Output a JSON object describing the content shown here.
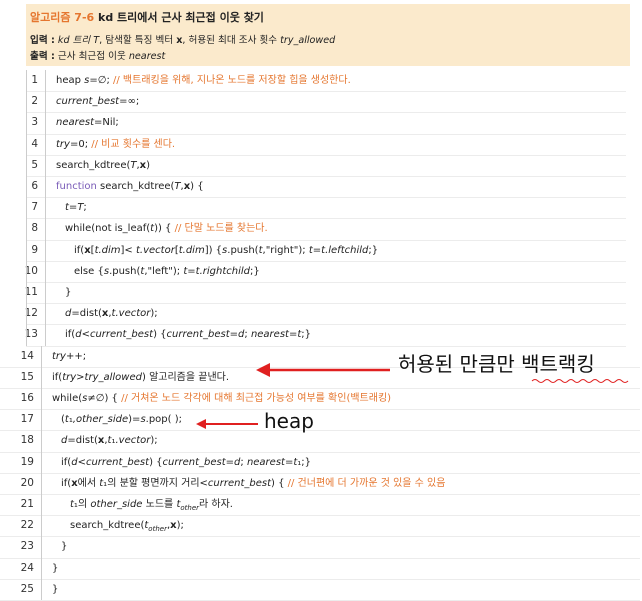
{
  "header": {
    "algorithm": "알고리즘 7-6",
    "title": "kd 트리에서 근사 최근접 이웃 찾기",
    "input_label": "입력 :",
    "input_text_1": " kd 트리 ",
    "input_T": "T",
    "input_text_2": ", 탐색할 특징 벡터 ",
    "input_x": "x",
    "input_text_3": ", 허용된 최대 조사 횟수 ",
    "input_try_allowed": "try_allowed",
    "output_label": "출력 :",
    "output_text": " 근사 최근접 이웃 ",
    "output_nearest": "nearest"
  },
  "code_lines": [
    {
      "num": "1",
      "html_parts": [
        {
          "t": "heap ",
          "s": ""
        },
        {
          "t": "s",
          "s": "i"
        },
        {
          "t": "=∅;  ",
          "s": ""
        },
        {
          "t": "// 백트래킹을 위해, 지나온 노드를 저장할 힙을 생성한다.",
          "s": "cm"
        }
      ]
    },
    {
      "num": "2",
      "html_parts": [
        {
          "t": "current_best",
          "s": "i"
        },
        {
          "t": "=∞;",
          "s": ""
        }
      ]
    },
    {
      "num": "3",
      "html_parts": [
        {
          "t": "nearest",
          "s": "i"
        },
        {
          "t": "=Nil;",
          "s": ""
        }
      ]
    },
    {
      "num": "4",
      "html_parts": [
        {
          "t": "try",
          "s": "i"
        },
        {
          "t": "=0;   ",
          "s": ""
        },
        {
          "t": "// 비교 횟수를 센다.",
          "s": "cm"
        }
      ]
    },
    {
      "num": "5",
      "html_parts": [
        {
          "t": "search_kdtree(",
          "s": ""
        },
        {
          "t": "T",
          "s": "i"
        },
        {
          "t": ",",
          "s": ""
        },
        {
          "t": "x",
          "s": "b"
        },
        {
          "t": ")",
          "s": ""
        }
      ]
    },
    {
      "num": "6",
      "html_parts": [
        {
          "t": "function",
          "s": "kw"
        },
        {
          "t": " search_kdtree(",
          "s": ""
        },
        {
          "t": "T",
          "s": "i"
        },
        {
          "t": ",",
          "s": ""
        },
        {
          "t": "x",
          "s": "b"
        },
        {
          "t": ") {",
          "s": ""
        }
      ]
    },
    {
      "num": "7",
      "html_parts": [
        {
          "t": "t",
          "s": "i"
        },
        {
          "t": "=",
          "s": ""
        },
        {
          "t": "T",
          "s": "i"
        },
        {
          "t": ";",
          "s": ""
        }
      ]
    },
    {
      "num": "8",
      "html_parts": [
        {
          "t": "while(not is_leaf(",
          "s": ""
        },
        {
          "t": "t",
          "s": "i"
        },
        {
          "t": ")) {  ",
          "s": ""
        },
        {
          "t": "// 단말 노드를 찾는다.",
          "s": "cm"
        }
      ]
    },
    {
      "num": "9",
      "html_parts": [
        {
          "t": "if(",
          "s": ""
        },
        {
          "t": "x",
          "s": "b"
        },
        {
          "t": "[",
          "s": ""
        },
        {
          "t": "t.dim",
          "s": "i"
        },
        {
          "t": "]< ",
          "s": ""
        },
        {
          "t": "t.vector",
          "s": "i"
        },
        {
          "t": "[",
          "s": ""
        },
        {
          "t": "t.dim",
          "s": "i"
        },
        {
          "t": "]) {",
          "s": ""
        },
        {
          "t": "s",
          "s": "i"
        },
        {
          "t": ".push(",
          "s": ""
        },
        {
          "t": "t",
          "s": "i"
        },
        {
          "t": ",\"right\"); ",
          "s": ""
        },
        {
          "t": "t",
          "s": "i"
        },
        {
          "t": "=",
          "s": ""
        },
        {
          "t": "t.leftchild",
          "s": "i"
        },
        {
          "t": ";}",
          "s": ""
        }
      ]
    },
    {
      "num": "10",
      "html_parts": [
        {
          "t": "else {",
          "s": ""
        },
        {
          "t": "s",
          "s": "i"
        },
        {
          "t": ".push(",
          "s": ""
        },
        {
          "t": "t",
          "s": "i"
        },
        {
          "t": ",\"left\"); ",
          "s": ""
        },
        {
          "t": "t",
          "s": "i"
        },
        {
          "t": "=",
          "s": ""
        },
        {
          "t": "t.rightchild",
          "s": "i"
        },
        {
          "t": ";}",
          "s": ""
        }
      ]
    },
    {
      "num": "11",
      "html_parts": [
        {
          "t": "}",
          "s": ""
        }
      ]
    },
    {
      "num": "12",
      "html_parts": [
        {
          "t": "d",
          "s": "i"
        },
        {
          "t": "=dist(",
          "s": ""
        },
        {
          "t": "x",
          "s": "b"
        },
        {
          "t": ",",
          "s": ""
        },
        {
          "t": "t.vector",
          "s": "i"
        },
        {
          "t": ");",
          "s": ""
        }
      ]
    },
    {
      "num": "13",
      "html_parts": [
        {
          "t": "if(",
          "s": ""
        },
        {
          "t": "d",
          "s": "i"
        },
        {
          "t": "<",
          "s": ""
        },
        {
          "t": "current_best",
          "s": "i"
        },
        {
          "t": ") {",
          "s": ""
        },
        {
          "t": "current_best",
          "s": "i"
        },
        {
          "t": "=",
          "s": ""
        },
        {
          "t": "d",
          "s": "i"
        },
        {
          "t": "; ",
          "s": ""
        },
        {
          "t": "nearest",
          "s": "i"
        },
        {
          "t": "=",
          "s": ""
        },
        {
          "t": "t",
          "s": "i"
        },
        {
          "t": ";}",
          "s": ""
        }
      ]
    },
    {
      "num": "14",
      "html_parts": [
        {
          "t": "try",
          "s": "i"
        },
        {
          "t": "++;",
          "s": ""
        }
      ]
    },
    {
      "num": "15",
      "html_parts": [
        {
          "t": "if(",
          "s": ""
        },
        {
          "t": "try",
          "s": "i"
        },
        {
          "t": ">",
          "s": ""
        },
        {
          "t": "try_allowed",
          "s": "i"
        },
        {
          "t": ") 알고리즘을 끝낸다.",
          "s": ""
        }
      ]
    },
    {
      "num": "16",
      "html_parts": [
        {
          "t": "while(",
          "s": ""
        },
        {
          "t": "s",
          "s": "i"
        },
        {
          "t": "≠∅) {  ",
          "s": ""
        },
        {
          "t": "// 거쳐온 노드 각각에 대해 최근접 가능성 여부를 확인(백트래킹)",
          "s": "cm"
        }
      ]
    },
    {
      "num": "17",
      "html_parts": [
        {
          "t": "(",
          "s": ""
        },
        {
          "t": "t",
          "s": "i"
        },
        {
          "t": "₁",
          "s": ""
        },
        {
          "t": ",other_side",
          "s": "i"
        },
        {
          "t": ")=",
          "s": ""
        },
        {
          "t": "s",
          "s": "i"
        },
        {
          "t": ".pop( );",
          "s": ""
        }
      ]
    },
    {
      "num": "18",
      "html_parts": [
        {
          "t": "d",
          "s": "i"
        },
        {
          "t": "=dist(",
          "s": ""
        },
        {
          "t": "x",
          "s": "b"
        },
        {
          "t": ",",
          "s": ""
        },
        {
          "t": "t",
          "s": "i"
        },
        {
          "t": "₁",
          "s": ""
        },
        {
          "t": ".vector",
          "s": "i"
        },
        {
          "t": ");",
          "s": ""
        }
      ]
    },
    {
      "num": "19",
      "html_parts": [
        {
          "t": "if(",
          "s": ""
        },
        {
          "t": "d",
          "s": "i"
        },
        {
          "t": "<",
          "s": ""
        },
        {
          "t": "current_best",
          "s": "i"
        },
        {
          "t": ") {",
          "s": ""
        },
        {
          "t": "current_best",
          "s": "i"
        },
        {
          "t": "=",
          "s": ""
        },
        {
          "t": "d",
          "s": "i"
        },
        {
          "t": "; ",
          "s": ""
        },
        {
          "t": "nearest",
          "s": "i"
        },
        {
          "t": "=",
          "s": ""
        },
        {
          "t": "t",
          "s": "i"
        },
        {
          "t": "₁",
          "s": ""
        },
        {
          "t": ";}",
          "s": ""
        }
      ]
    },
    {
      "num": "20",
      "html_parts": [
        {
          "t": "if(",
          "s": ""
        },
        {
          "t": "x",
          "s": "b"
        },
        {
          "t": "에서 ",
          "s": ""
        },
        {
          "t": "t",
          "s": "i"
        },
        {
          "t": "₁",
          "s": ""
        },
        {
          "t": "의 분할 평면까지 거리<",
          "s": ""
        },
        {
          "t": "current_best",
          "s": "i"
        },
        {
          "t": ") {  ",
          "s": ""
        },
        {
          "t": "// 건너편에 더 가까운 것 있을 수 있음",
          "s": "cm"
        }
      ]
    },
    {
      "num": "21",
      "html_parts": [
        {
          "t": "t",
          "s": "i"
        },
        {
          "t": "₁",
          "s": ""
        },
        {
          "t": "의 ",
          "s": ""
        },
        {
          "t": "other_side",
          "s": "i"
        },
        {
          "t": " 노드를 ",
          "s": ""
        },
        {
          "t": "t",
          "s": "i"
        },
        {
          "t": "other",
          "s": "isub"
        },
        {
          "t": "라 하자.",
          "s": ""
        }
      ]
    },
    {
      "num": "22",
      "html_parts": [
        {
          "t": "search_kdtree(",
          "s": ""
        },
        {
          "t": "t",
          "s": "i"
        },
        {
          "t": "other",
          "s": "isub"
        },
        {
          "t": ",",
          "s": ""
        },
        {
          "t": "x",
          "s": "b"
        },
        {
          "t": ");",
          "s": ""
        }
      ]
    },
    {
      "num": "23",
      "html_parts": [
        {
          "t": "}",
          "s": ""
        }
      ]
    },
    {
      "num": "24",
      "html_parts": [
        {
          "t": "}",
          "s": ""
        }
      ]
    },
    {
      "num": "25",
      "html_parts": [
        {
          "t": "}",
          "s": ""
        }
      ]
    }
  ],
  "annotations": {
    "backtrack_note": "허용된 만큼만 백트랙킹",
    "heap_note": "heap",
    "arrow_color": "#e02020"
  },
  "colors": {
    "header_bg": "#fbeacc",
    "algorithm_accent": "#e5762f",
    "comment": "#e5762f",
    "keyword": "#7a5cb8"
  }
}
